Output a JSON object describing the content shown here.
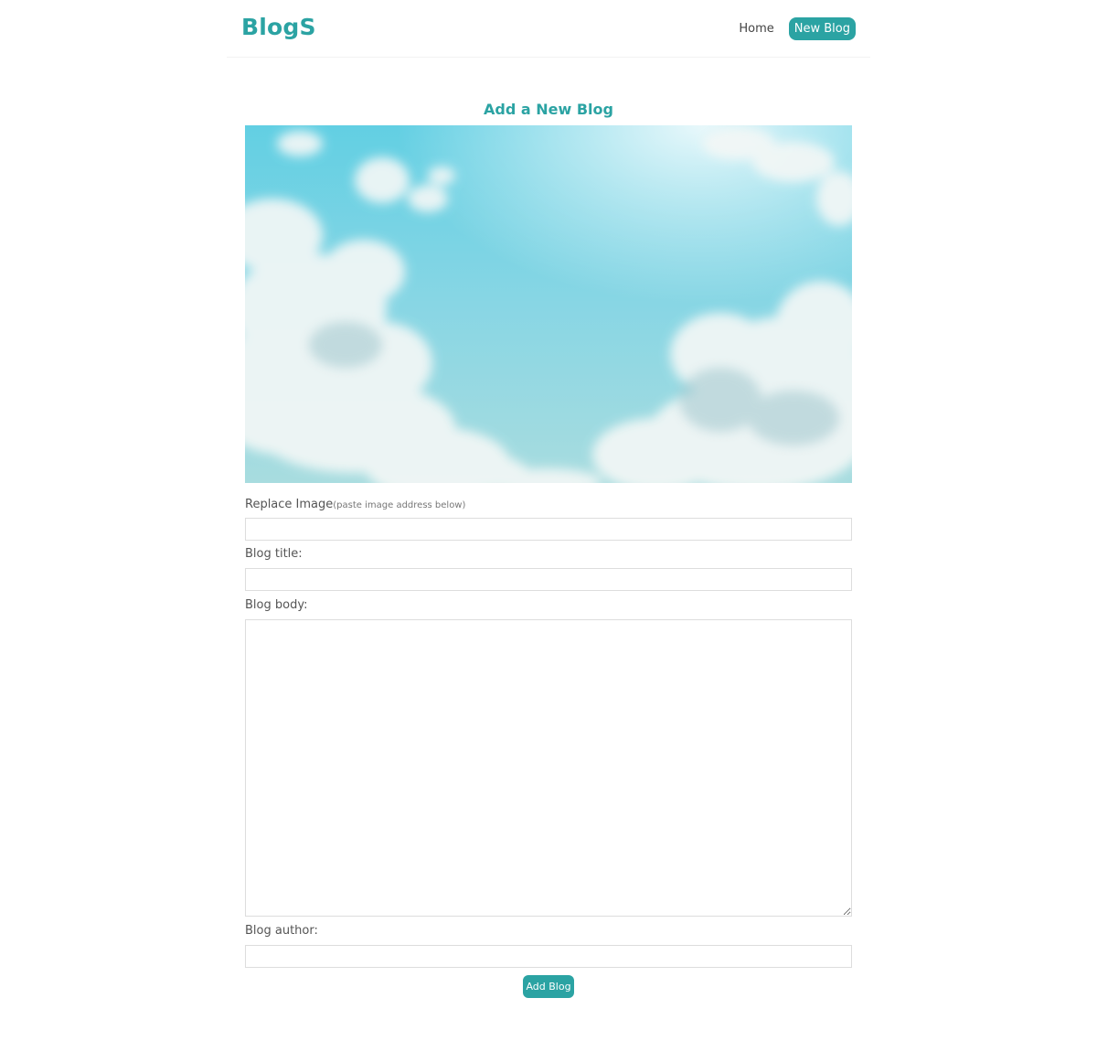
{
  "nav": {
    "brand": "BlogS",
    "home_label": "Home",
    "new_blog_label": "New Blog"
  },
  "page": {
    "title": "Add a New Blog"
  },
  "form": {
    "image": {
      "label": "Replace Image",
      "hint": "(paste image address below)",
      "value": ""
    },
    "title": {
      "label": "Blog title:",
      "value": ""
    },
    "body": {
      "label": "Blog body:",
      "value": ""
    },
    "author": {
      "label": "Blog author:",
      "value": ""
    },
    "submit_label": "Add Blog"
  },
  "colors": {
    "accent": "#2ba3a3",
    "sky_light": "#8fdbea",
    "sky_dark": "#5cc4d6",
    "cloud": "#f4f8f8"
  },
  "icons": {
    "textarea_resize": "resize-grip-icon"
  }
}
